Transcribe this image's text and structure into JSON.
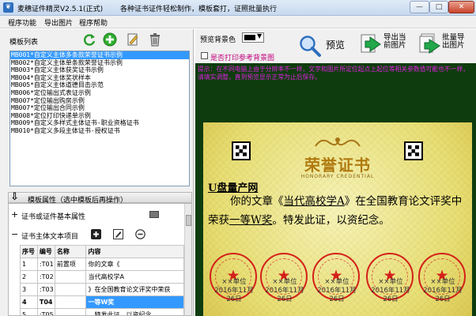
{
  "window": {
    "icon": "❦",
    "title": "麦穗证件精灵V2.5.1(正式)",
    "subtitle": "各种证书证件轻松制作，模板套打，证照批量执行",
    "min": "—",
    "max": "□",
    "close": "✕"
  },
  "menu": [
    "程序功能",
    "导出图片",
    "程序帮助"
  ],
  "left": {
    "list_label": "模板列表",
    "templates": [
      "MB001*自定义主体多条款荣誉证书示例",
      "MB002*自定义主体单条款荣誉证书示例",
      "MB003*自定义主体获奖证书示例",
      "MB004*自定义主体奖状样本",
      "MB005*自定义主体道德目击示范",
      "MB006*定位输出式表证示例",
      "MB007*定位输出购房示例",
      "MB007*定位输出合同示例",
      "MB008*定位打印快递单示例",
      "MB009*自定义多样式主体证书-职业资格证书",
      "MB010*自定义多段主体证书-授权证书"
    ],
    "props_arrow": "⇩",
    "props_title": "模板属性（选中模板后再操作）",
    "tree_items": [
      {
        "pm": "+",
        "label": "证书或证件基本属性"
      },
      {
        "pm": "−",
        "label": "证书主体文本项目"
      }
    ],
    "table": {
      "headers": [
        "序号",
        "编号",
        "名称",
        "内容"
      ],
      "rows": [
        [
          "1",
          ":T01",
          "前置项",
          "你的文章《"
        ],
        [
          "2",
          ":T02",
          "",
          "当代高校学A"
        ],
        [
          "3",
          ":T03",
          "",
          "》在全国教育论文评奖中荣获"
        ],
        [
          "4",
          "T04",
          "",
          "一等W奖"
        ],
        [
          "5",
          ":T05",
          "",
          "。特发此证，以资纪念。"
        ]
      ]
    }
  },
  "right": {
    "bg_label": "预览背景色",
    "print_bg_label": "是否打印参考背景图",
    "preview_btn": "预览",
    "export_current": [
      "导出当",
      "前图片"
    ],
    "batch_export": [
      "批量导",
      "出图片"
    ],
    "warning": "提示：在不同电脑上由于分辨率不一样，文字和图片所定位起点上起位等相关参数值可能也不一样，请填实调整，直到预览显示正常为止后保存。",
    "colors": {
      "preview_bg": "#000000",
      "seal": "#d4201a",
      "cert_title": "#b07a10",
      "highlight": "#3399ff"
    }
  },
  "certificate": {
    "title": "荣誉证书",
    "title_en": "HONORARY CREDENTIAL",
    "recipient": "U盘量产网",
    "body_a": "你的文章《",
    "body_b": "当代高校学A",
    "body_c": "》在全国教育论文评奖中荣获",
    "body_d": "一等W奖",
    "body_e": "。特发此证，以资纪念。",
    "signatures": [
      {
        "org": "××单位",
        "date": "2016年11月26日"
      },
      {
        "org": "××单位",
        "date": "2016年11月26日"
      },
      {
        "org": "××单位",
        "date": "2016年11月26日"
      },
      {
        "org": "××单位",
        "date": "2016年11月26日"
      },
      {
        "org": "××单位",
        "date": "2016年11月26日"
      }
    ]
  }
}
